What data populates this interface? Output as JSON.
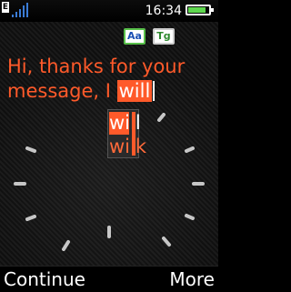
{
  "status": {
    "sim_label": "E",
    "time": "16:34",
    "signal_bars": 5,
    "battery_level": 0.85,
    "icons": [
      "sim-icon",
      "signal-icon",
      "battery-icon"
    ]
  },
  "input_modes": {
    "case_mode_label": "Aa",
    "language_label": "Tg"
  },
  "message": {
    "line1": "Hi, thanks for your",
    "line2_prefix": "message, I ",
    "highlighted_word": "will"
  },
  "suggestions": {
    "items": [
      "will",
      "wilk"
    ],
    "selected_index": 0
  },
  "softkeys": {
    "left": "Continue",
    "right": "More"
  },
  "colors": {
    "accent": "#ff5a2a",
    "text": "#ffffff",
    "background": "#111111",
    "battery": "#5fd84f"
  }
}
